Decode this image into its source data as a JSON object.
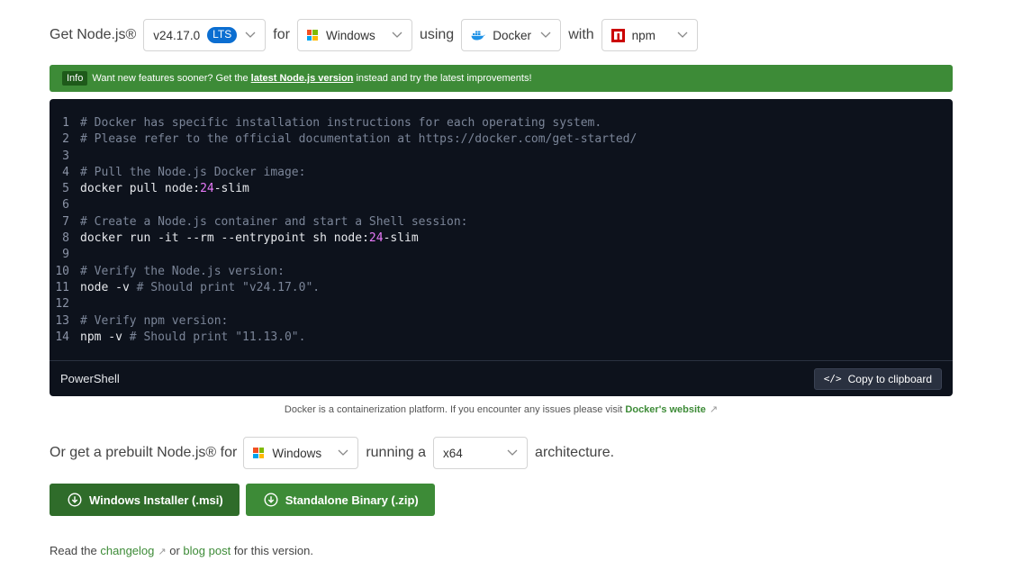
{
  "selector_row": {
    "get_label": "Get Node.js®",
    "version_value": "v24.17.0",
    "version_badge": "LTS",
    "for_label": "for",
    "os_value": "Windows",
    "using_label": "using",
    "method_value": "Docker",
    "with_label": "with",
    "pm_value": "npm"
  },
  "info_banner": {
    "tag": "Info",
    "text_before": "Want new features sooner? Get the",
    "link": "latest Node.js version",
    "text_after": "instead and try the latest improvements!"
  },
  "code_block": {
    "lines": [
      {
        "n": "1",
        "comment": "# Docker has specific installation instructions for each operating system."
      },
      {
        "n": "2",
        "comment": "# Please refer to the official documentation at https://docker.com/get-started/"
      },
      {
        "n": "3"
      },
      {
        "n": "4",
        "comment": "# Pull the Node.js Docker image:"
      },
      {
        "n": "5",
        "code": "docker pull node:",
        "num": "24",
        "code2": "-slim"
      },
      {
        "n": "6"
      },
      {
        "n": "7",
        "comment": "# Create a Node.js container and start a Shell session:"
      },
      {
        "n": "8",
        "code": "docker run -it --rm --entrypoint sh node:",
        "num": "24",
        "code2": "-slim"
      },
      {
        "n": "9"
      },
      {
        "n": "10",
        "comment": "# Verify the Node.js version:"
      },
      {
        "n": "11",
        "code": "node -v ",
        "comment": "# Should print \"v24.17.0\"."
      },
      {
        "n": "12"
      },
      {
        "n": "13",
        "comment": "# Verify npm version:"
      },
      {
        "n": "14",
        "code": "npm -v ",
        "comment": "# Should print \"11.13.0\"."
      }
    ],
    "language": "PowerShell",
    "copy_label": "Copy to clipboard"
  },
  "docker_note": {
    "text": "Docker is a containerization platform. If you encounter any issues please visit",
    "link": "Docker's website"
  },
  "prebuilt_row": {
    "prefix": "Or get a prebuilt Node.js® for",
    "os_value": "Windows",
    "running_label": "running a",
    "arch_value": "x64",
    "suffix": "architecture."
  },
  "download_buttons": {
    "installer": "Windows Installer (.msi)",
    "binary": "Standalone Binary (.zip)"
  },
  "footer": {
    "read": "Read the",
    "changelog": "changelog",
    "or": "or",
    "blog": "blog post",
    "tail": "for this version."
  },
  "colors": {
    "accent_green": "#3d8b37",
    "dark_green": "#2f6c2a",
    "code_bg": "#0d121c",
    "lts_blue": "#0b6ed1"
  },
  "icons": [
    "chevron-down-icon",
    "windows-icon",
    "docker-icon",
    "npm-icon",
    "code-icon",
    "download-icon",
    "external-link-icon"
  ]
}
